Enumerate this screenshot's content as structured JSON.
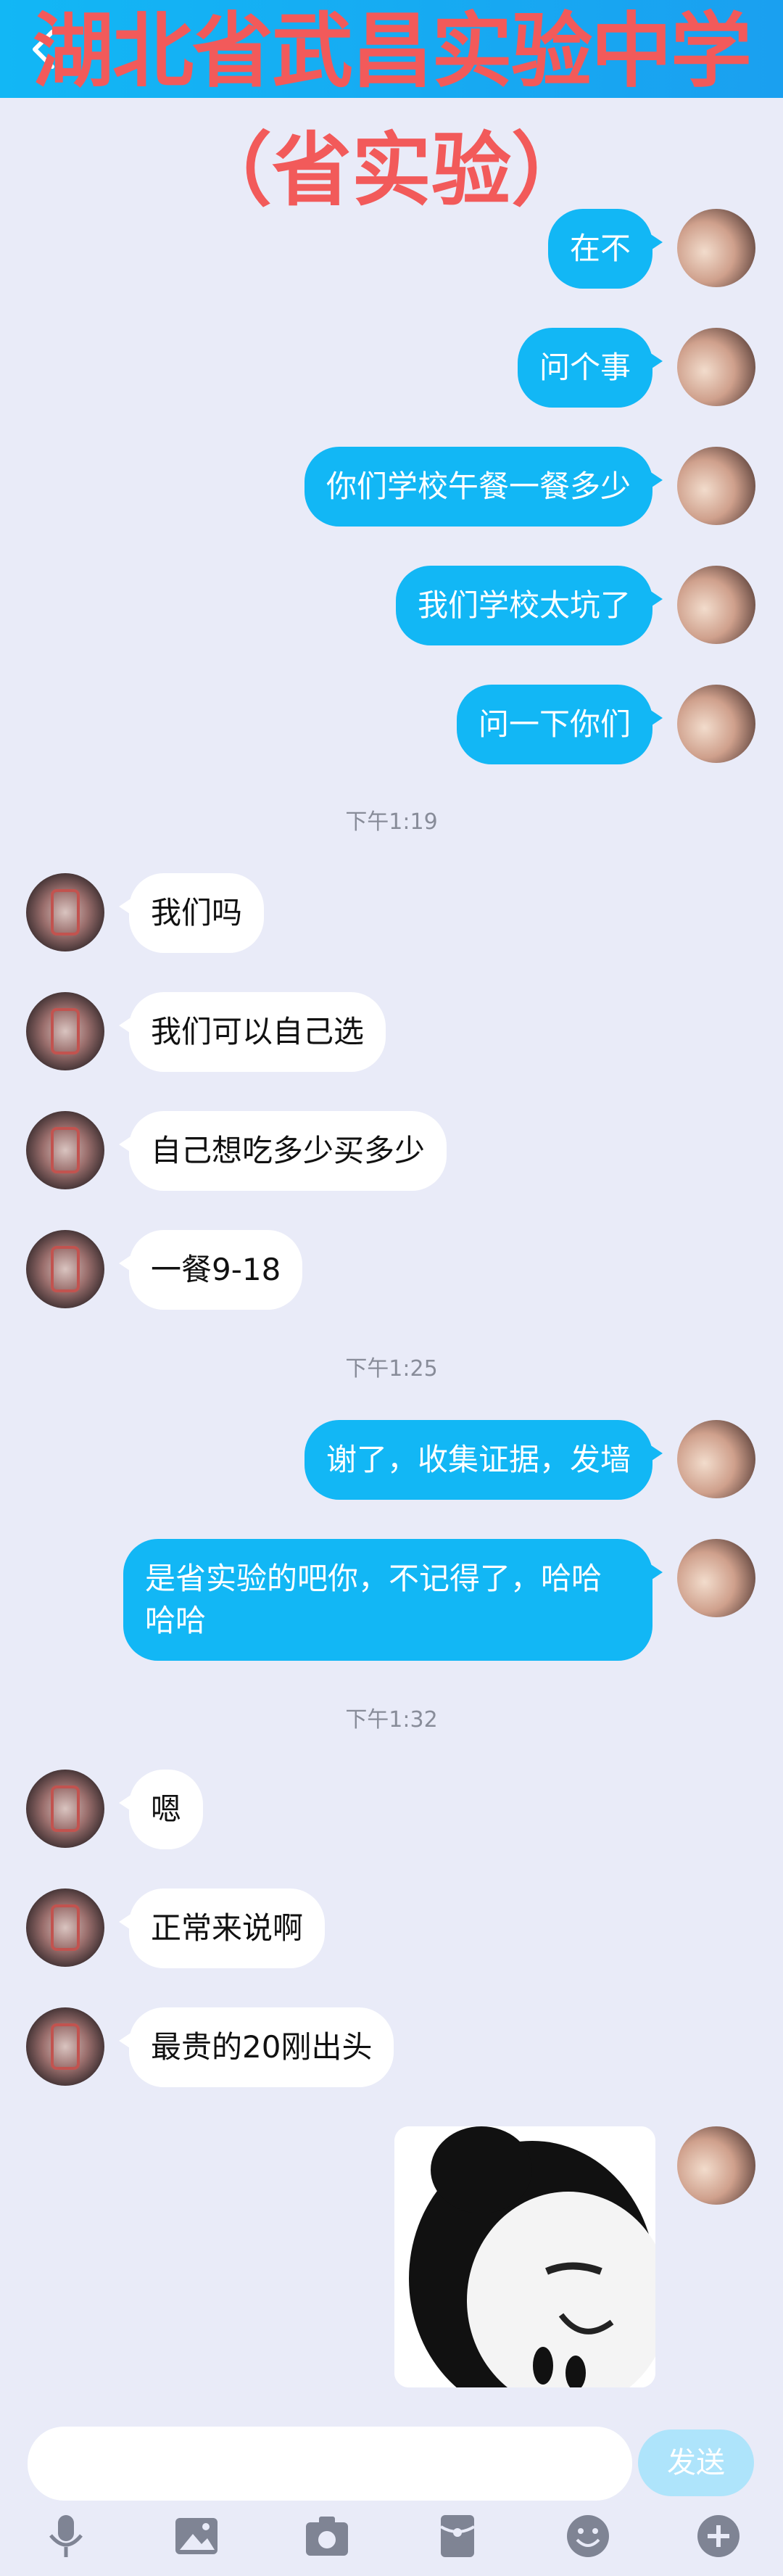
{
  "header": {
    "overlay_title": "湖北省武昌实验中学",
    "overlay_subtitle": "（省实验）"
  },
  "messages": [
    {
      "side": "me",
      "text": "在不"
    },
    {
      "side": "me",
      "text": "问个事"
    },
    {
      "side": "me",
      "text": "你们学校午餐一餐多少"
    },
    {
      "side": "me",
      "text": "我们学校太坑了"
    },
    {
      "side": "me",
      "text": "问一下你们"
    },
    {
      "time": "下午1:19"
    },
    {
      "side": "other",
      "text": "我们吗"
    },
    {
      "side": "other",
      "text": "我们可以自己选"
    },
    {
      "side": "other",
      "text": "自己想吃多少买多少"
    },
    {
      "side": "other",
      "text": "一餐9-18"
    },
    {
      "time": "下午1:25"
    },
    {
      "side": "me",
      "text": "谢了，收集证据，发墙"
    },
    {
      "side": "me",
      "text": "是省实验的吧你，不记得了，哈哈哈哈"
    },
    {
      "time": "下午1:32"
    },
    {
      "side": "other",
      "text": "嗯"
    },
    {
      "side": "other",
      "text": "正常来说啊"
    },
    {
      "side": "other",
      "text": "最贵的20刚出头"
    },
    {
      "side": "me",
      "sticker": "panda-meme-sticker"
    }
  ],
  "input": {
    "placeholder": ""
  },
  "send_button": {
    "label": "发送"
  },
  "toolbar": [
    "mic-icon",
    "image-icon",
    "camera-icon",
    "red-packet-icon",
    "emoji-icon",
    "plus-icon"
  ],
  "colors": {
    "my_bubble": "#12b7f5",
    "other_bubble": "#ffffff",
    "background": "#e9ebf8",
    "overlay_text": "#f25a5a"
  }
}
